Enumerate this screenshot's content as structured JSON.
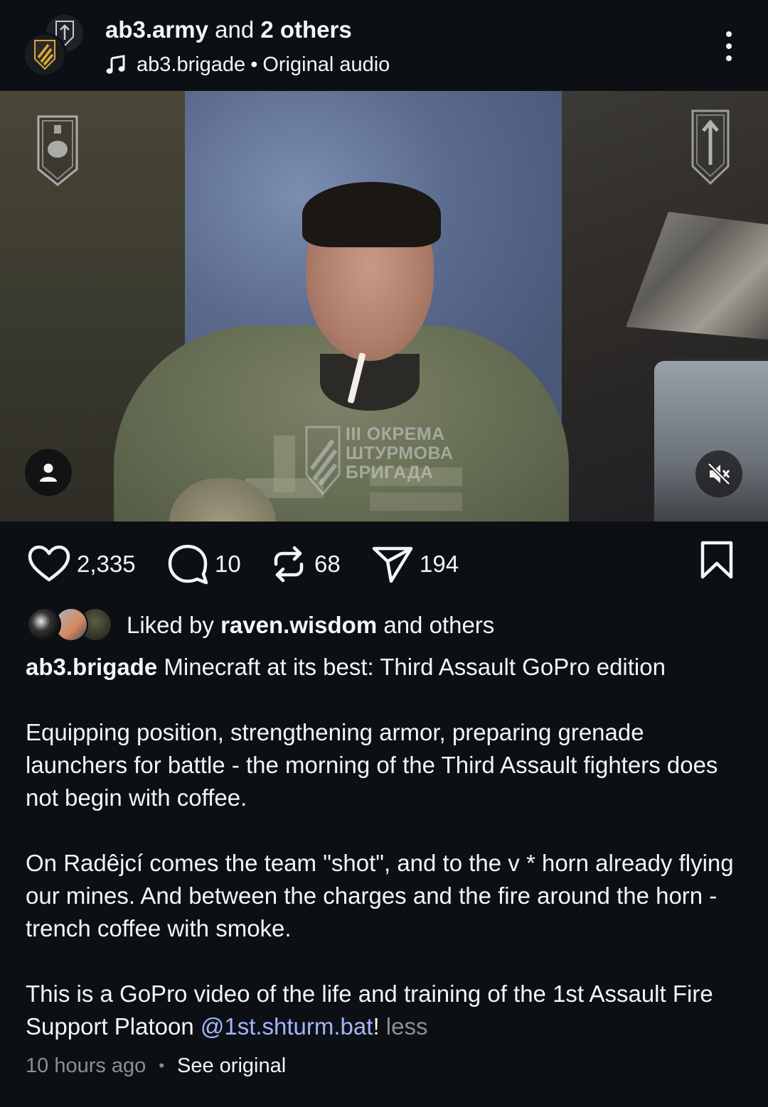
{
  "header": {
    "account": "ab3.army",
    "and_text": "and",
    "others_count": "2 others",
    "audio_account": "ab3.brigade",
    "audio_separator": "•",
    "audio_label": "Original audio"
  },
  "video": {
    "watermark_lines": [
      "III ОКРЕМА",
      "ШТУРМОВА",
      "БРИГАДА"
    ],
    "muted": true
  },
  "actions": {
    "likes": "2,335",
    "comments": "10",
    "reposts": "68",
    "shares": "194"
  },
  "liked_by": {
    "prefix": "Liked by",
    "user": "raven.wisdom",
    "suffix": "and others"
  },
  "caption": {
    "author": "ab3.brigade",
    "line1": "Minecraft at its best: Third Assault GoPro edition",
    "para2": "Equipping position, strengthening armor, preparing grenade launchers for battle - the morning of the Third Assault fighters does not begin with coffee.",
    "para3": "On Radêjcí comes the team \"shot\", and to the v * horn already flying our mines. And between the charges and the fire around the horn - trench coffee with smoke.",
    "para4_text": "This is a GoPro video of the life and training of the 1st Assault Fire Support Platoon",
    "mention_mark": "@",
    "mention": "1st.shturm.bat",
    "para4_end": "!",
    "less": "less"
  },
  "meta": {
    "time": "10 hours ago",
    "separator": "•",
    "see_original": "See original"
  },
  "colors": {
    "background": "#0c1014",
    "text": "#f5f5f5",
    "muted": "#8e8e8e",
    "mention": "#a5b4fc"
  }
}
